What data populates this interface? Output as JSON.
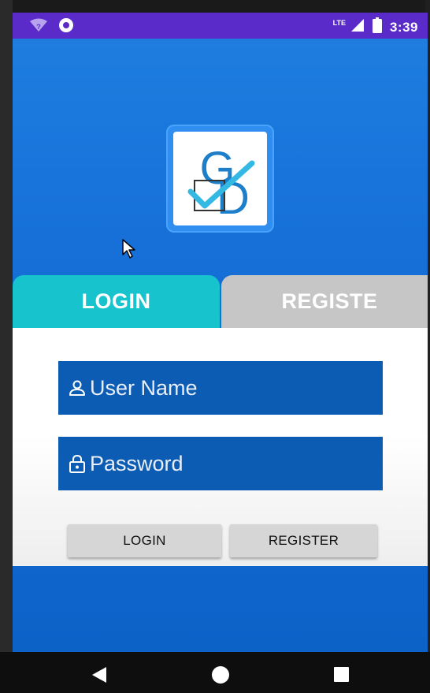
{
  "status_bar": {
    "time": "3:39",
    "network_label": "LTE",
    "icons": [
      "wifi-question-icon",
      "notification-circle-icon",
      "cell-signal-icon",
      "battery-icon"
    ]
  },
  "logo": {
    "letters": "GD"
  },
  "tabs": [
    {
      "label": "LOGIN",
      "active": true
    },
    {
      "label": "REGISTE",
      "active": false
    }
  ],
  "form": {
    "username": {
      "placeholder": "User Name",
      "value": "",
      "icon": "user-icon"
    },
    "password": {
      "placeholder": "Password",
      "value": "",
      "icon": "lock-icon"
    }
  },
  "buttons": {
    "login": "LOGIN",
    "register": "REGISTER"
  },
  "colors": {
    "status_bar": "#5a2bc9",
    "background_blue": "#1670d8",
    "tab_active": "#17c3cc",
    "tab_inactive": "#c6c6c6",
    "field_bg": "#0c5cb4",
    "button_bg": "#d6d6d6"
  },
  "nav_bar": {
    "icons": [
      "back-icon",
      "home-icon",
      "recents-icon"
    ]
  }
}
